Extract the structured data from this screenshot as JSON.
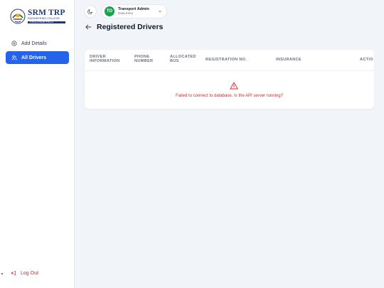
{
  "brand": {
    "name": "SRM TRP",
    "subtitle": "ENGINEERING COLLEGE",
    "location": "TIRUCHIRAPPALLI"
  },
  "sidebar": {
    "items": [
      {
        "label": "Add Details",
        "icon": "plus-circle-icon"
      },
      {
        "label": "All Drivers",
        "icon": "users-icon",
        "active": true
      }
    ],
    "logout_label": "Log Out"
  },
  "header": {
    "theme_icon": "moon-icon",
    "user": {
      "initials": "TO",
      "name": "Transport Admin",
      "role": "Data Entry"
    }
  },
  "page": {
    "title": "Registered Drivers"
  },
  "table": {
    "columns": [
      "DRIVER INFORMATION",
      "PHONE NUMBER",
      "ALLOCATED BUS",
      "REGISTRATION NO.",
      "INSURANCE",
      "ACTIO"
    ],
    "error_message": "Failed to connect to database. Is the API server running?"
  },
  "colors": {
    "accent": "#2563eb",
    "error": "#dc2626",
    "avatar": "#16a34a",
    "background": "#f1f5fa"
  }
}
